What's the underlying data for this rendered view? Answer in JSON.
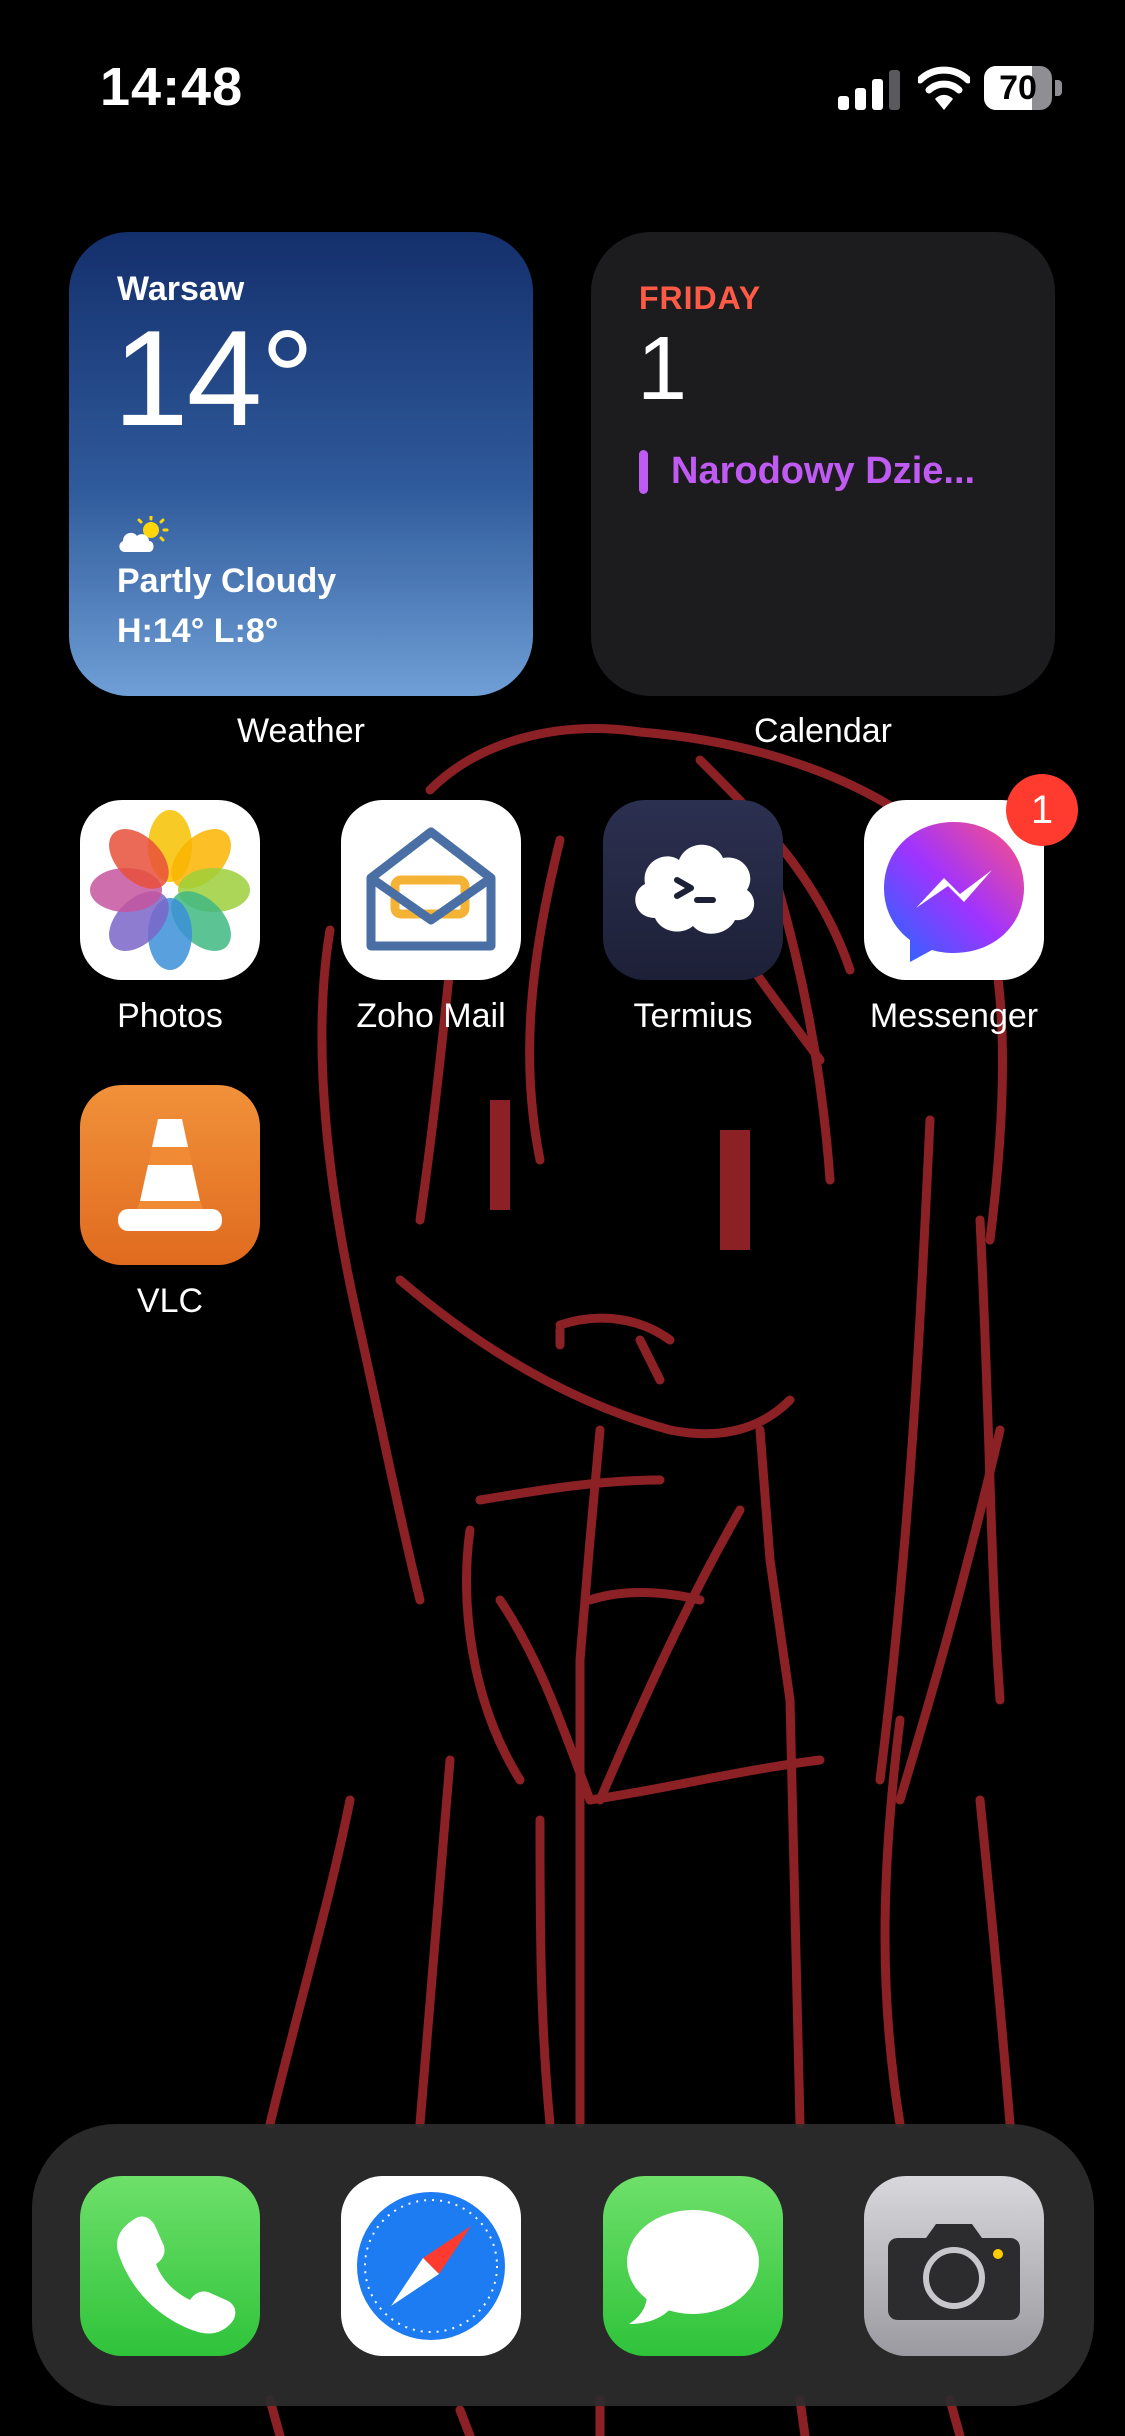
{
  "status_bar": {
    "time": "14:48",
    "battery_percent": 70,
    "battery_label": "70",
    "signal_bars": 3
  },
  "widgets": {
    "weather": {
      "city": "Warsaw",
      "temperature": "14°",
      "condition": "Partly Cloudy",
      "high_low": "H:14° L:8°",
      "label": "Weather",
      "icon": "partly-cloudy-icon"
    },
    "calendar": {
      "weekday": "FRIDAY",
      "date": "1",
      "event": "Narodowy Dzie...",
      "label": "Calendar"
    }
  },
  "apps": [
    {
      "label": "Photos",
      "icon": "photos-icon"
    },
    {
      "label": "Zoho Mail",
      "icon": "zoho-mail-icon"
    },
    {
      "label": "Termius",
      "icon": "termius-icon"
    },
    {
      "label": "Messenger",
      "icon": "messenger-icon",
      "badge": "1"
    },
    {
      "label": "VLC",
      "icon": "vlc-icon"
    }
  ],
  "dock": [
    {
      "icon": "phone-icon"
    },
    {
      "icon": "safari-icon"
    },
    {
      "icon": "messages-icon"
    },
    {
      "icon": "camera-icon"
    }
  ],
  "colors": {
    "calendar_accent": "#ff5a45",
    "event_purple": "#bf5af2",
    "badge_red": "#ff3b30",
    "wallpaper_line": "#8b2025"
  }
}
